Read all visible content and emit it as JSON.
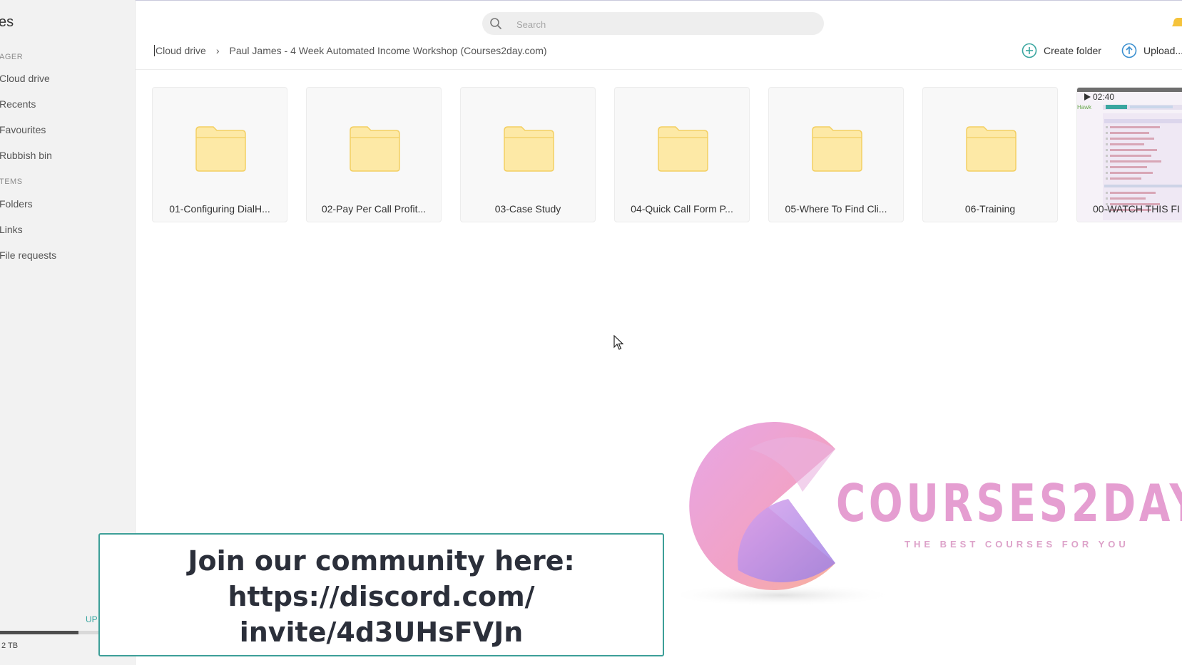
{
  "sidebar": {
    "title": "es",
    "sections": [
      {
        "label": "AGER"
      },
      {
        "label": "TEMS"
      }
    ],
    "items": [
      {
        "label": "Cloud drive"
      },
      {
        "label": "Recents"
      },
      {
        "label": "Favourites"
      },
      {
        "label": "Rubbish bin"
      },
      {
        "label": "Folders"
      },
      {
        "label": "Links"
      },
      {
        "label": "File requests"
      }
    ],
    "upgrade_label": "UP",
    "storage_text": "2 TB",
    "storage_used_fraction": 0.58
  },
  "search": {
    "placeholder": "Search",
    "icon": "search-icon"
  },
  "breadcrumb": {
    "root": "Cloud drive",
    "current": "Paul James - 4 Week Automated Income Workshop (Courses2day.com)"
  },
  "actions": {
    "create_folder": "Create folder",
    "upload": "Upload..."
  },
  "tiles": [
    {
      "name": "01-Configuring DialH...",
      "icon": "folder-icon"
    },
    {
      "name": "02-Pay Per Call Profit...",
      "icon": "folder-icon"
    },
    {
      "name": "03-Case Study",
      "icon": "folder-icon"
    },
    {
      "name": "04-Quick Call Form P...",
      "icon": "folder-icon"
    },
    {
      "name": "05-Where To Find Cli...",
      "icon": "folder-icon"
    },
    {
      "name": "06-Training",
      "icon": "folder-icon"
    }
  ],
  "video_tile": {
    "name": "00-WATCH THIS FI",
    "duration": "02:40",
    "icon": "play-icon"
  },
  "watermark": {
    "brand": "COURSES2DAY",
    "tagline": "THE BEST COURSES FOR YOU"
  },
  "banner": {
    "line1": "Join our community here:",
    "line2": "https://discord.com/",
    "line3": "invite/4d3UHsFVJn"
  },
  "colors": {
    "accent": "#3aa6a0",
    "folder": "#fde9a6",
    "folder_edge": "#f3cf62",
    "banner_border": "#3d9f98",
    "upload_icon": "#3a8fd0"
  }
}
